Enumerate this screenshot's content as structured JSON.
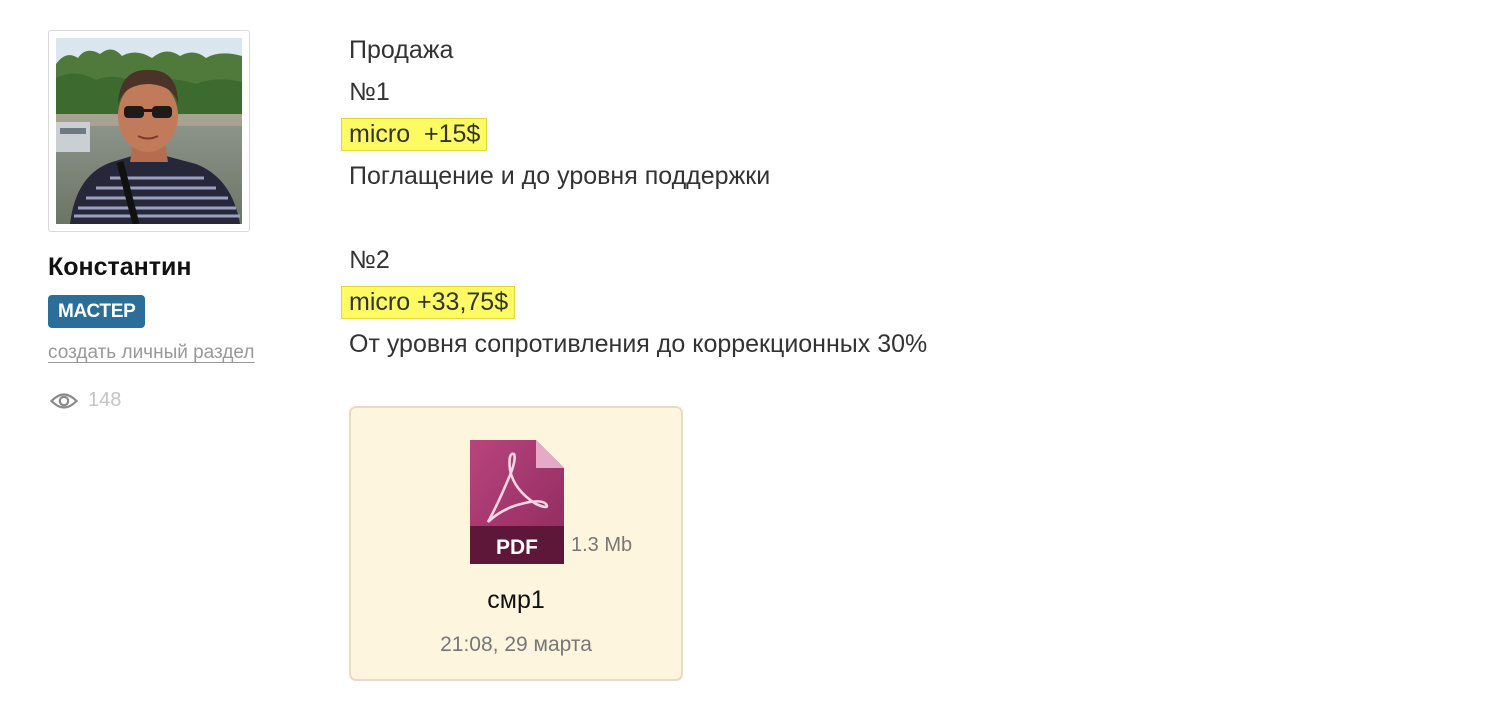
{
  "author": {
    "name": "Константин",
    "rank": "МАСТЕР",
    "personal_link": "создать личный раздел",
    "views": "148"
  },
  "post": {
    "title": "Продажа",
    "items": [
      {
        "number": "№1",
        "result": "micro  +15$",
        "description": "Поглащение и до уровня поддержки"
      },
      {
        "number": "№2",
        "result": "micro +33,75$",
        "description": "От уровня сопротивления до коррекционных 30%"
      }
    ]
  },
  "attachment": {
    "type_label": "PDF",
    "size": "1.3 Mb",
    "name": "смр1",
    "date": "21:08, 29 марта"
  },
  "colors": {
    "highlight": "#fdfb63",
    "rank_badge": "#2b6e99",
    "attachment_bg": "#fef5df",
    "pdf_icon": "#a9356f"
  },
  "icons": {
    "views": "eye-icon",
    "attachment": "pdf-file-icon"
  }
}
